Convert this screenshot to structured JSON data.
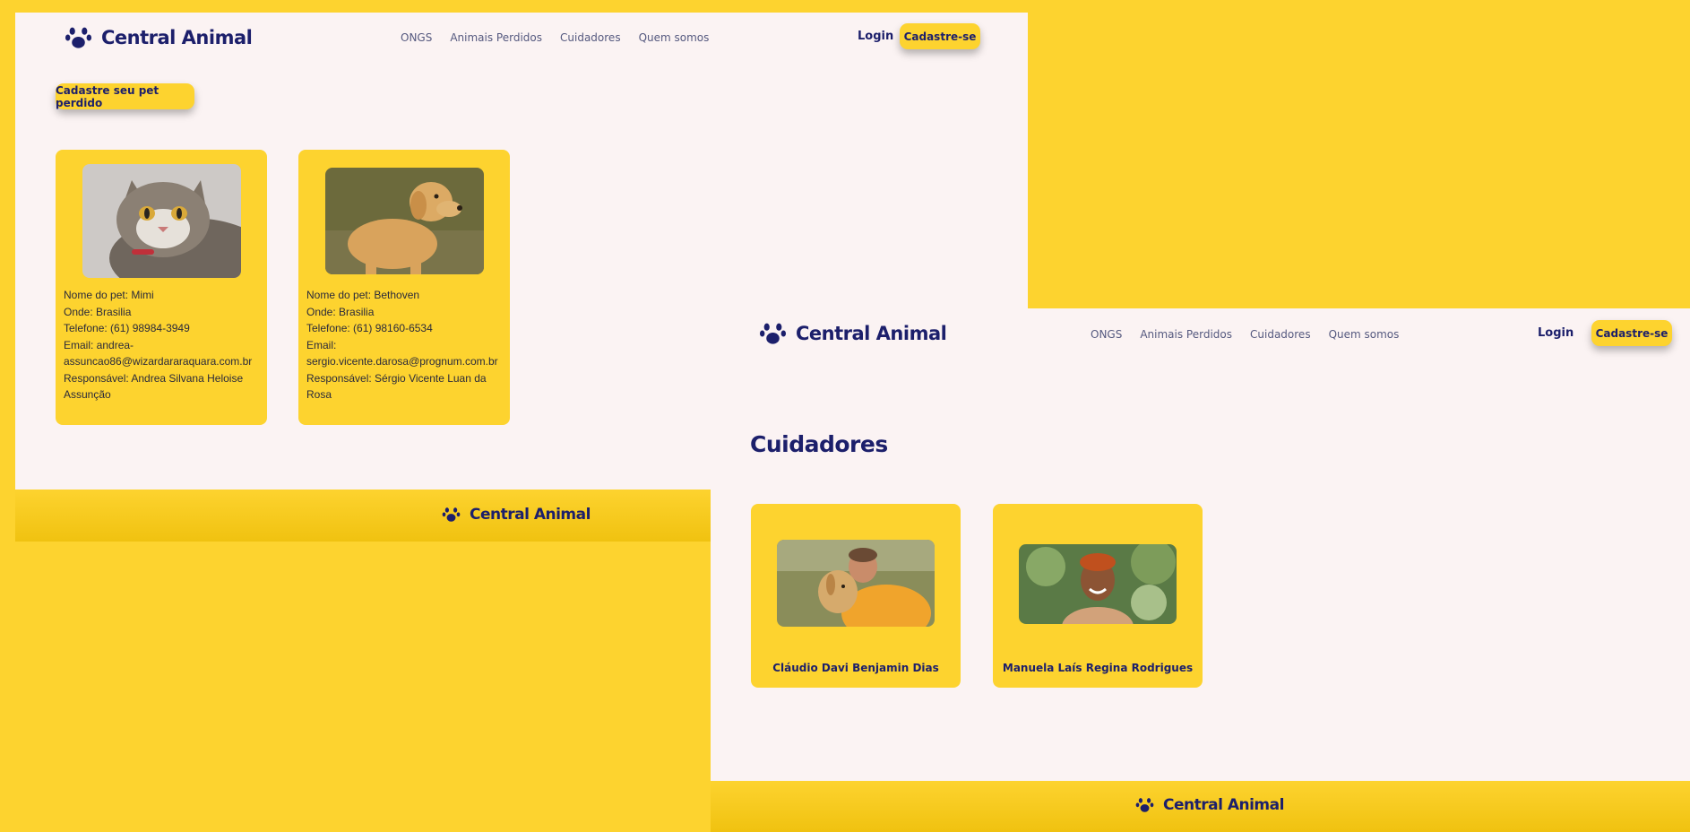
{
  "brand": {
    "name": "Central Animal",
    "color": "#1c1f6b",
    "accent": "#fdd32f",
    "page_bg": "#fbf3f3"
  },
  "nav": {
    "links": [
      "ONGS",
      "Animais Perdidos",
      "Cuidadores",
      "Quem somos"
    ],
    "login_label": "Login",
    "signup_label": "Cadastre-se"
  },
  "lost_pets_page": {
    "register_button": "Cadastre seu pet perdido",
    "pets": [
      {
        "photo": "tabby-cat-photo",
        "lines": [
          "Nome do pet: Mimi",
          "Onde: Brasilia",
          "Telefone: (61) 98984-3949",
          "Email: andrea-",
          "assuncao86@wizardararaquara.com.br",
          "Responsável: Andrea Silvana Heloise",
          "Assunção"
        ]
      },
      {
        "photo": "golden-retriever-photo",
        "lines": [
          "Nome do pet: Bethoven",
          "Onde: Brasilia",
          "Telefone: (61) 98160-6534",
          "Email:",
          "sergio.vicente.darosa@prognum.com.br",
          "Responsável: Sérgio Vicente Luan da",
          "Rosa"
        ]
      }
    ]
  },
  "caregivers_page": {
    "title": "Cuidadores",
    "caregivers": [
      {
        "name": "Cláudio Davi Benjamin Dias",
        "photo": "man-hugging-dog-photo"
      },
      {
        "name": "Manuela Laís Regina Rodrigues",
        "photo": "smiling-woman-photo"
      }
    ]
  },
  "icons": {
    "logo": "paw-icon"
  }
}
